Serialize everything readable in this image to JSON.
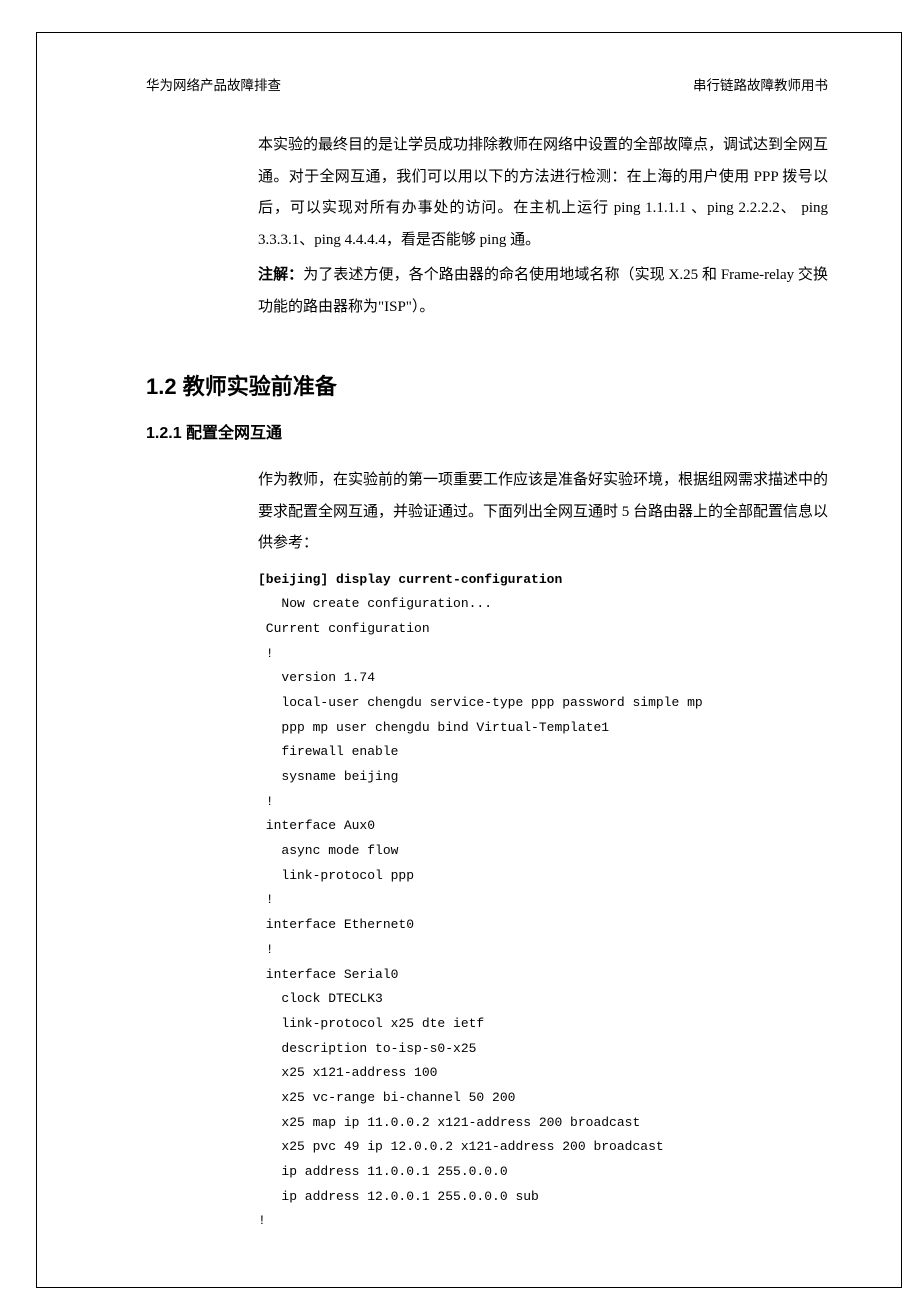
{
  "header": {
    "left": "华为网络产品故障排查",
    "right": "串行链路故障教师用书"
  },
  "intro": {
    "p1": "本实验的最终目的是让学员成功排除教师在网络中设置的全部故障点，调试达到全网互通。对于全网互通，我们可以用以下的方法进行检测：在上海的用户使用 PPP 拨号以后，可以实现对所有办事处的访问。在主机上运行 ping 1.1.1.1 、ping 2.2.2.2、 ping 3.3.3.1、ping 4.4.4.4，看是否能够 ping 通。",
    "note_label": "注解：",
    "note_body": "为了表述方便，各个路由器的命名使用地域名称（实现 X.25 和 Frame-relay 交换功能的路由器称为\"ISP\"）。"
  },
  "h2": "1.2  教师实验前准备",
  "h3": "1.2.1  配置全网互通",
  "section_body": "作为教师，在实验前的第一项重要工作应该是准备好实验环境，根据组网需求描述中的要求配置全网互通，并验证通过。下面列出全网互通时 5 台路由器上的全部配置信息以供参考：",
  "code": {
    "cmd": "[beijing] display current-configuration",
    "lines": "   Now create configuration...\n Current configuration\n !\n   version 1.74\n   local-user chengdu service-type ppp password simple mp\n   ppp mp user chengdu bind Virtual-Template1\n   firewall enable\n   sysname beijing\n !\n interface Aux0\n   async mode flow\n   link-protocol ppp\n !\n interface Ethernet0\n !\n interface Serial0\n   clock DTECLK3\n   link-protocol x25 dte ietf\n   description to-isp-s0-x25\n   x25 x121-address 100\n   x25 vc-range bi-channel 50 200\n   x25 map ip 11.0.0.2 x121-address 200 broadcast\n   x25 pvc 49 ip 12.0.0.2 x121-address 200 broadcast\n   ip address 11.0.0.1 255.0.0.0\n   ip address 12.0.0.1 255.0.0.0 sub\n!"
  }
}
